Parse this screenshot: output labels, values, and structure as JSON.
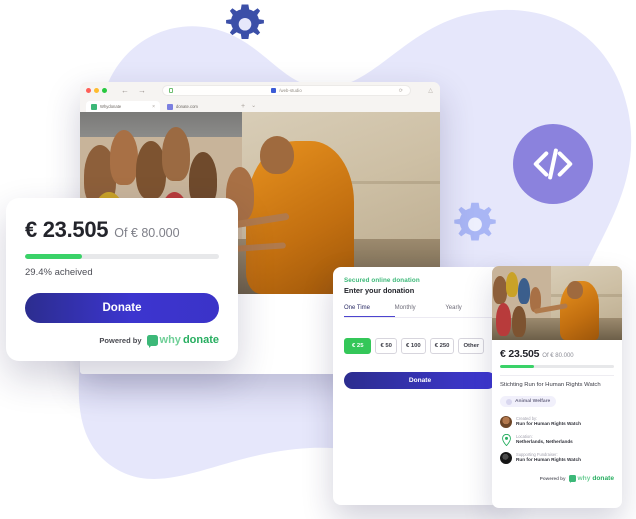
{
  "theme": {
    "blob_color": "#e6e7fb",
    "accent_purple": "#8b82dd",
    "gear_dark": "#3b4fa8",
    "gear_light": "#a9b6f5",
    "green": "#3ad268",
    "donate_blue": "#3c35cf",
    "select_green": "#34c759"
  },
  "decor": {
    "gear_top_name": "gear-icon",
    "gear_mid_name": "gear-icon",
    "code_badge_glyph": "</>"
  },
  "browser": {
    "window_controls": [
      "close",
      "minimize",
      "maximize"
    ],
    "back_glyph": "←",
    "forward_glyph": "→",
    "url_text": "/web-studio",
    "reload_glyph": "⟳",
    "profile_glyph": "△",
    "tabs": [
      {
        "label": "Whydonate",
        "favicon": "green",
        "active": true,
        "close_glyph": "×"
      },
      {
        "label": "donate.com",
        "favicon": "blue",
        "active": false,
        "close_glyph": ""
      }
    ],
    "new_tab_glyph": "+",
    "tab_menu_glyph": "⌄"
  },
  "progress_card": {
    "amount_raised": "€ 23.505",
    "goal_text": "Of € 80.000",
    "percent_value": 29.4,
    "percent_label": "29.4% acheived",
    "donate_label": "Donate",
    "powered_by_label": "Powered by",
    "brand_part1": "why",
    "brand_part2": "donate"
  },
  "donation_form": {
    "secured_label": "Secured online donation",
    "title": "Enter your donation",
    "tabs": [
      {
        "label": "One Time",
        "active": true
      },
      {
        "label": "Monthly",
        "active": false
      },
      {
        "label": "Yearly",
        "active": false
      }
    ],
    "amounts": [
      {
        "label": "€ 25",
        "selected": true
      },
      {
        "label": "€ 50",
        "selected": false
      },
      {
        "label": "€ 100",
        "selected": false
      },
      {
        "label": "€ 250",
        "selected": false
      },
      {
        "label": "Other",
        "selected": false
      }
    ],
    "donate_label": "Donate"
  },
  "campaign_card": {
    "amount_raised": "€ 23.505",
    "goal_text": "Of € 80.000",
    "percent_value": 29.4,
    "title": "Stichting Run for Human Rights Watch",
    "category_badge": "Animal Welfare",
    "meta": [
      {
        "label": "Created by:",
        "value": "Run for Human Rights Watch",
        "icon": "avatar-person-icon"
      },
      {
        "label": "Location:",
        "value": "Netherlands, Netherlands",
        "icon": "location-pin-icon"
      },
      {
        "label": "Supporting Fundraiser:",
        "value": "Run for Human Rights Watch",
        "icon": "avatar-org-icon"
      }
    ],
    "powered_by_label": "Powered by",
    "brand_part1": "why",
    "brand_part2": "donate"
  }
}
